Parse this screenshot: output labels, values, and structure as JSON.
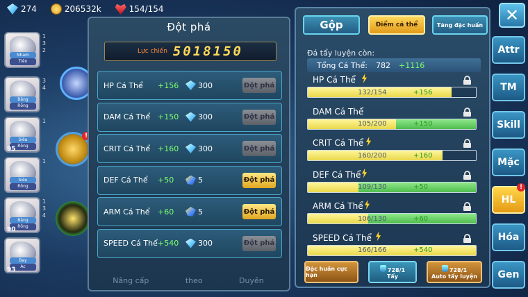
{
  "resources": {
    "gems": "274",
    "gold": "206532k",
    "stamina": "154/154"
  },
  "team": [
    {
      "tag": "Tiên",
      "tag2": "Nham",
      "level": "",
      "nums": [
        "1",
        "3",
        "2"
      ]
    },
    {
      "tag": "Rồng",
      "tag2": "Băng",
      "level": "",
      "nums": [
        "3",
        "",
        "4"
      ]
    },
    {
      "tag": "Rồng",
      "tag2": "Siêu",
      "level": "95",
      "nums": [
        "1",
        "",
        ""
      ]
    },
    {
      "tag": "Rồng",
      "tag2": "Siêu",
      "level": "",
      "nums": [
        "1",
        "",
        ""
      ]
    },
    {
      "tag": "Rồng",
      "tag2": "Băng",
      "level": "90",
      "nums": [
        "1",
        "3",
        "4"
      ]
    },
    {
      "tag": "Ác",
      "tag2": "Bay",
      "level": "93",
      "nums": [
        "",
        "",
        ""
      ]
    }
  ],
  "breakthrough": {
    "title": "Đột phá",
    "power_label": "Lực chiến",
    "power_value": "5018150",
    "rows": [
      {
        "name": "HP Cá Thể",
        "bonus": "+156",
        "cost": "300",
        "cost_icon": "gem-icon",
        "button": "Đột phá",
        "active": false
      },
      {
        "name": "DAM Cá Thể",
        "bonus": "+150",
        "cost": "300",
        "cost_icon": "gem-icon",
        "button": "Đột phá",
        "active": false
      },
      {
        "name": "CRIT Cá Thể",
        "bonus": "+160",
        "cost": "300",
        "cost_icon": "gem-icon",
        "button": "Đột phá",
        "active": false
      },
      {
        "name": "DEF Cá Thể",
        "bonus": "+50",
        "cost": "5",
        "cost_icon": "stone-icon",
        "button": "Đột phá",
        "active": true
      },
      {
        "name": "ARM Cá Thể",
        "bonus": "+60",
        "cost": "5",
        "cost_icon": "stone-icon",
        "button": "Đột phá",
        "active": true
      },
      {
        "name": "SPEED Cá Thể",
        "bonus": "+540",
        "cost": "300",
        "cost_icon": "gem-icon",
        "button": "Đột phá",
        "active": false
      }
    ],
    "bottom_tabs": [
      "Nâng cấp",
      "theo",
      "Duyên"
    ]
  },
  "training": {
    "tabs": {
      "gop": "Gộp",
      "diem": "Điểm cá thể",
      "tang": "Tăng đặc huấn"
    },
    "remaining_label": "Đá tẩy luyện còn:",
    "total_label": "Tổng Cá Thể:",
    "total_value": "782",
    "total_plus": "+1116",
    "stats": [
      {
        "name": "HP Cá Thể",
        "value": "132/154",
        "plus": "+156",
        "fill": 0.857,
        "gfill": 0.0,
        "bolt": true
      },
      {
        "name": "DAM Cá Thể",
        "value": "105/200",
        "plus": "+150",
        "fill": 0.525,
        "gfill": 0.475,
        "bolt": false
      },
      {
        "name": "CRIT Cá Thể",
        "value": "160/200",
        "plus": "+160",
        "fill": 0.8,
        "gfill": 0.0,
        "bolt": true
      },
      {
        "name": "DEF Cá Thể",
        "value": "109/130",
        "plus": "+50",
        "fill": 0.3,
        "gfill": 0.7,
        "bolt": true
      },
      {
        "name": "ARM Cá Thể",
        "value": "106/130",
        "plus": "+60",
        "fill": 0.36,
        "gfill": 0.64,
        "bolt": true
      },
      {
        "name": "SPEED Cá Thể",
        "value": "166/166",
        "plus": "+540",
        "fill": 1.0,
        "gfill": 0.0,
        "bolt": true
      }
    ],
    "actions": [
      {
        "label": "Đặc huấn cực hạn",
        "count": ""
      },
      {
        "label": "Tẩy",
        "count": "728/1"
      },
      {
        "label": "Auto tẩy luyện",
        "count": "728/1"
      }
    ]
  },
  "side_nav": [
    "Attr",
    "TM",
    "Skill",
    "Mặc",
    "HL",
    "Hóa",
    "Gen"
  ],
  "colors": {
    "accent": "#ffd64a",
    "bonus": "#7dff6e",
    "panel": "#1d3650"
  }
}
